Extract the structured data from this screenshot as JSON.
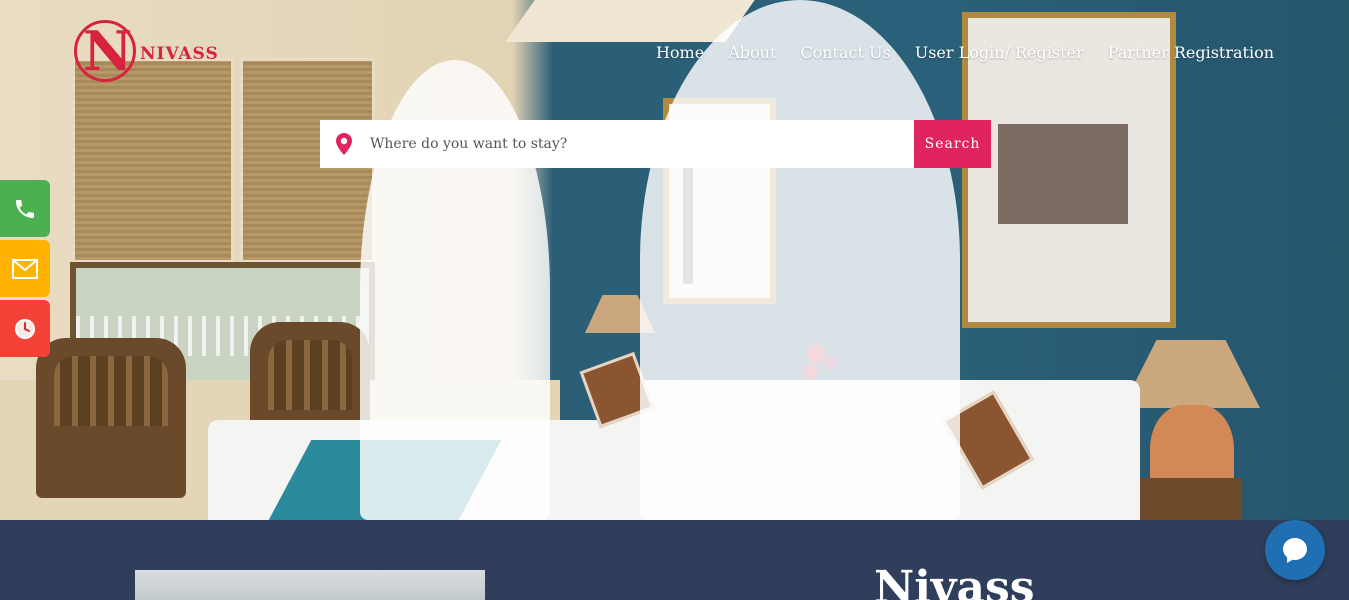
{
  "brand": {
    "logo_letter": "N",
    "logo_text": "NIVASS",
    "color": "#d6243c"
  },
  "nav": {
    "items": [
      {
        "label": "Home"
      },
      {
        "label": "About"
      },
      {
        "label": "Contact Us"
      },
      {
        "label": "User Login/ Register"
      },
      {
        "label": "Partner Registration"
      }
    ]
  },
  "search": {
    "placeholder": "Where do you want to stay?",
    "value": "",
    "button_label": "Search",
    "button_color": "#e0245e"
  },
  "side_contacts": [
    {
      "icon": "phone-icon",
      "color": "#4caf50"
    },
    {
      "icon": "mail-icon",
      "color": "#ffb300"
    },
    {
      "icon": "clock-icon",
      "color": "#f44336"
    }
  ],
  "section": {
    "heading": "Nivass"
  },
  "chat": {
    "icon": "chat-bubble-icon",
    "color": "#1f6fb2"
  }
}
